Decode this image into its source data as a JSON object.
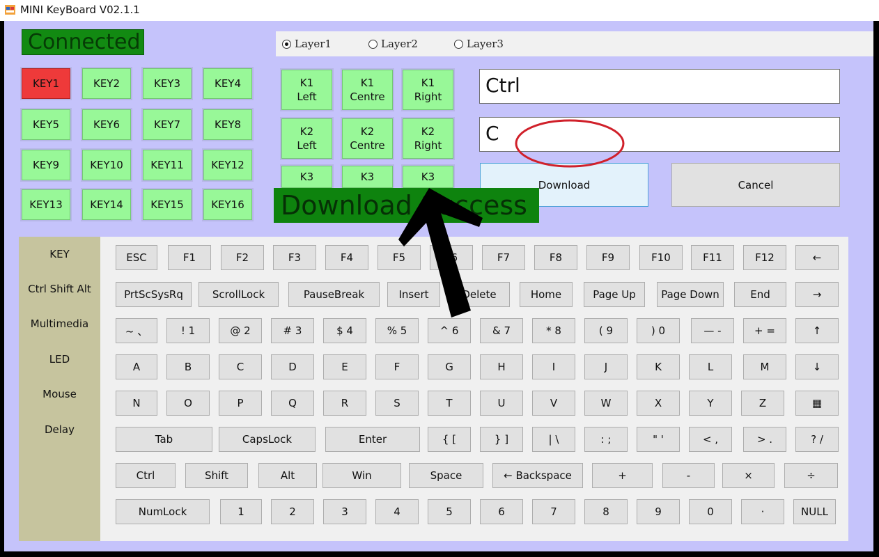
{
  "window": {
    "title": "MINI KeyBoard V02.1.1"
  },
  "status": {
    "connected_label": "Connected"
  },
  "layers": [
    {
      "label": "Layer1",
      "selected": true
    },
    {
      "label": "Layer2",
      "selected": false
    },
    {
      "label": "Layer3",
      "selected": false
    }
  ],
  "keys": [
    "KEY1",
    "KEY2",
    "KEY3",
    "KEY4",
    "KEY5",
    "KEY6",
    "KEY7",
    "KEY8",
    "KEY9",
    "KEY10",
    "KEY11",
    "KEY12",
    "KEY13",
    "KEY14",
    "KEY15",
    "KEY16"
  ],
  "active_key": "KEY1",
  "knobs": [
    {
      "line1": "K1",
      "line2": "Left"
    },
    {
      "line1": "K1",
      "line2": "Centre"
    },
    {
      "line1": "K1",
      "line2": "Right"
    },
    {
      "line1": "K2",
      "line2": "Left"
    },
    {
      "line1": "K2",
      "line2": "Centre"
    },
    {
      "line1": "K2",
      "line2": "Right"
    },
    {
      "line1": "K3",
      "line2": ""
    },
    {
      "line1": "K3",
      "line2": ""
    },
    {
      "line1": "K3",
      "line2": ""
    }
  ],
  "mapping": {
    "modifier_value": "Ctrl",
    "key_value": "C"
  },
  "actions": {
    "download_label": "Download",
    "cancel_label": "Cancel"
  },
  "banner": {
    "text": "Download Success"
  },
  "categories": [
    "KEY",
    "Ctrl Shift Alt",
    "Multimedia",
    "LED",
    "Mouse",
    "Delay"
  ],
  "keyboard_rows": [
    [
      "ESC",
      "F1",
      "F2",
      "F3",
      "F4",
      "F5",
      "F6",
      "F7",
      "F8",
      "F9",
      "F10",
      "F11",
      "F12",
      "←"
    ],
    [
      "PrtScSysRq",
      "ScrollLock",
      "PauseBreak",
      "Insert",
      "Delete",
      "Home",
      "Page Up",
      "Page Down",
      "End",
      "→"
    ],
    [
      "~ 、",
      "! 1",
      "@ 2",
      "# 3",
      "$ 4",
      "% 5",
      "^ 6",
      "& 7",
      "* 8",
      "( 9",
      ") 0",
      "— -",
      "+ =",
      "↑"
    ],
    [
      "A",
      "B",
      "C",
      "D",
      "E",
      "F",
      "G",
      "H",
      "I",
      "J",
      "K",
      "L",
      "M",
      "↓"
    ],
    [
      "N",
      "O",
      "P",
      "Q",
      "R",
      "S",
      "T",
      "U",
      "V",
      "W",
      "X",
      "Y",
      "Z",
      "▦"
    ],
    [
      "Tab",
      "CapsLock",
      "Enter",
      "{ [",
      "} ]",
      "| \\",
      ": ;",
      "\" '",
      "< ,",
      "> .",
      "? /"
    ],
    [
      "Ctrl",
      "Shift",
      "Alt",
      "Win",
      "Space",
      "← Backspace",
      "+",
      "-",
      "×",
      "÷"
    ],
    [
      "NumLock",
      "1",
      "2",
      "3",
      "4",
      "5",
      "6",
      "7",
      "8",
      "9",
      "0",
      "·",
      "NULL"
    ]
  ],
  "colors": {
    "background": "#c5c3fb",
    "connected": "#128a12",
    "key_default": "#98f898",
    "key_active": "#ee3a3a",
    "annotation_red": "#d0202a",
    "arrow": "#000000"
  }
}
